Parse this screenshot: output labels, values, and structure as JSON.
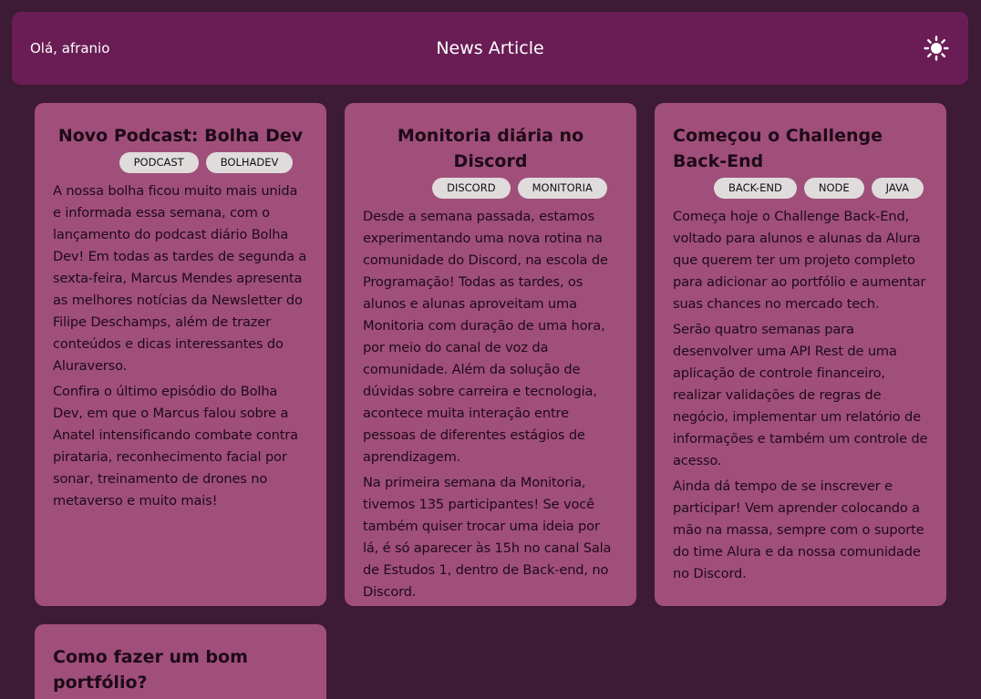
{
  "header": {
    "greeting": "Olá, afranio",
    "title": "News Article",
    "theme_icon": "sun-icon"
  },
  "articles": [
    {
      "title": "Novo Podcast: Bolha Dev",
      "tags": [
        "PODCAST",
        "BOLHADEV"
      ],
      "paragraphs": [
        "A nossa bolha ficou muito mais unida e informada essa semana, com o lançamento do podcast diário Bolha Dev! Em todas as tardes de segunda a sexta-feira, Marcus Mendes apresenta as melhores notícias da Newsletter do Filipe Deschamps, além de trazer conteúdos e dicas interessantes do Aluraverso.",
        "Confira o último episódio do Bolha Dev, em que o Marcus falou sobre a Anatel intensificando combate contra pirataria, reconhecimento facial por sonar, treinamento de drones no metaverso e muito mais!"
      ]
    },
    {
      "title": "Monitoria diária no Discord",
      "tags": [
        "DISCORD",
        "MONITORIA"
      ],
      "paragraphs": [
        "Desde a semana passada, estamos experimentando uma nova rotina na comunidade do Discord, na escola de Programação! Todas as tardes, os alunos e alunas aproveitam uma Monitoria com duração de uma hora, por meio do canal de voz da comunidade. Além da solução de dúvidas sobre carreira e tecnologia, acontece muita interação entre pessoas de diferentes estágios de aprendizagem.",
        "Na primeira semana da Monitoria, tivemos 135 participantes! Se você também quiser trocar uma ideia por lá, é só aparecer às 15h no canal Sala de Estudos 1, dentro de Back-end, no Discord."
      ]
    },
    {
      "title": "Começou o Challenge Back-End",
      "tags": [
        "BACK-END",
        "NODE",
        "JAVA"
      ],
      "paragraphs": [
        "Começa hoje o Challenge Back-End, voltado para alunos e alunas da Alura que querem ter um projeto completo para adicionar ao portfólio e aumentar suas chances no mercado tech.",
        "Serão quatro semanas para desenvolver uma API Rest de uma aplicação de controle financeiro, realizar validações de regras de negócio, implementar um relatório de informações e também um controle de acesso.",
        "Ainda dá tempo de se inscrever e participar! Vem aprender colocando a mão na massa, sempre com o suporte do time Alura e da nossa comunidade no Discord."
      ]
    },
    {
      "title": "Como fazer um bom portfólio?",
      "tags": [],
      "paragraphs": []
    }
  ]
}
